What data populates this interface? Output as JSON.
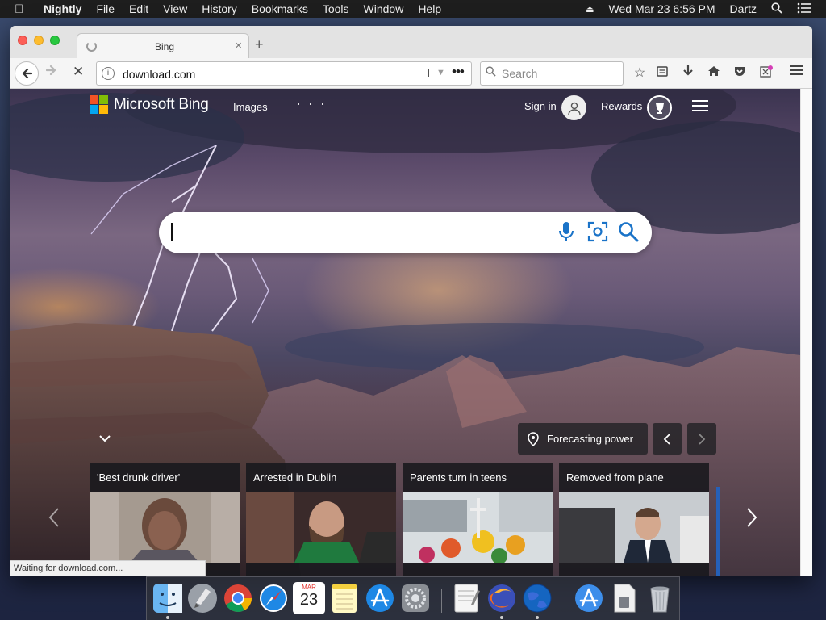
{
  "menubar": {
    "app_name": "Nightly",
    "items": [
      "File",
      "Edit",
      "View",
      "History",
      "Bookmarks",
      "Tools",
      "Window",
      "Help"
    ],
    "clock": "Wed Mar 23  6:56 PM",
    "user": "Dartz"
  },
  "browser": {
    "tab_title": "Bing",
    "url": "download.com",
    "search_placeholder": "Search",
    "status_text": "Waiting for download.com..."
  },
  "bing": {
    "logo_text": "Microsoft Bing",
    "nav_images": "Images",
    "more_label": "· · ·",
    "signin_label": "Sign in",
    "rewards_label": "Rewards",
    "image_location": "Forecasting power",
    "news": [
      {
        "title": "'Best drunk driver'"
      },
      {
        "title": "Arrested in Dublin"
      },
      {
        "title": "Parents turn in teens"
      },
      {
        "title": "Removed from plane"
      }
    ]
  },
  "dock": {
    "calendar_month": "MAR",
    "calendar_day": "23"
  },
  "colors": {
    "accent_blue": "#1a73c8",
    "bing_red": "#f35325",
    "bing_green": "#81bc06",
    "bing_blue": "#05a6f0",
    "bing_yellow": "#ffba08"
  }
}
